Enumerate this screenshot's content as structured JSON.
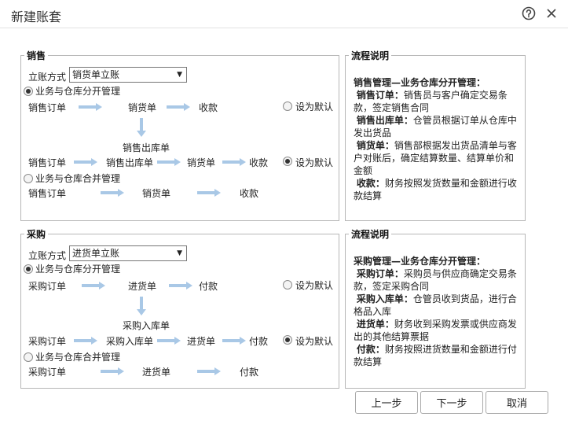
{
  "window": {
    "title": "新建账套"
  },
  "sales": {
    "legend": "销售",
    "method_label": "立账方式",
    "method_value": "销货单立账",
    "mode_split": "业务与仓库分开管理",
    "mode_merge": "业务与仓库合并管理",
    "set_default": "设为默认",
    "flow1": [
      "销售订单",
      "销货单",
      "收款"
    ],
    "outbound_label": "销售出库单",
    "flow2": [
      "销售订单",
      "销售出库单",
      "销货单",
      "收款"
    ],
    "flow3": [
      "销售订单",
      "销货单",
      "收款"
    ]
  },
  "sales_desc": {
    "legend": "流程说明",
    "heading": "销售管理—业务仓库分开管理：",
    "items": [
      {
        "term": "销售订单：",
        "text": "销售员与客户确定交易条款，签定销售合同"
      },
      {
        "term": "销售出库单：",
        "text": "仓管员根据订单从仓库中发出货品"
      },
      {
        "term": "销货单：",
        "text": "销售部根据发出货品清单与客户对账后，确定结算数量、结算单价和金额"
      },
      {
        "term": "收款：",
        "text": "财务按照发货数量和金额进行收款结算"
      }
    ]
  },
  "purchase": {
    "legend": "采购",
    "method_label": "立账方式",
    "method_value": "进货单立账",
    "mode_split": "业务与仓库分开管理",
    "mode_merge": "业务与仓库合并管理",
    "set_default": "设为默认",
    "flow1": [
      "采购订单",
      "进货单",
      "付款"
    ],
    "inbound_label": "采购入库单",
    "flow2": [
      "采购订单",
      "采购入库单",
      "进货单",
      "付款"
    ],
    "flow3": [
      "采购订单",
      "进货单",
      "付款"
    ]
  },
  "purchase_desc": {
    "legend": "流程说明",
    "heading": "采购管理—业务仓库分开管理：",
    "items": [
      {
        "term": "采购订单：",
        "text": "采购员与供应商确定交易条款，签定采购合同"
      },
      {
        "term": "采购入库单：",
        "text": "仓管员收到货品，进行合格品入库"
      },
      {
        "term": "进货单：",
        "text": "财务收到采购发票或供应商发出的其他结算票据"
      },
      {
        "term": "付款：",
        "text": "财务按照进货数量和金额进行付款结算"
      }
    ]
  },
  "buttons": {
    "prev": "上一步",
    "next": "下一步",
    "cancel": "取消"
  },
  "colors": {
    "arrow": "#a9c8e6",
    "border": "#b7b7b7"
  }
}
